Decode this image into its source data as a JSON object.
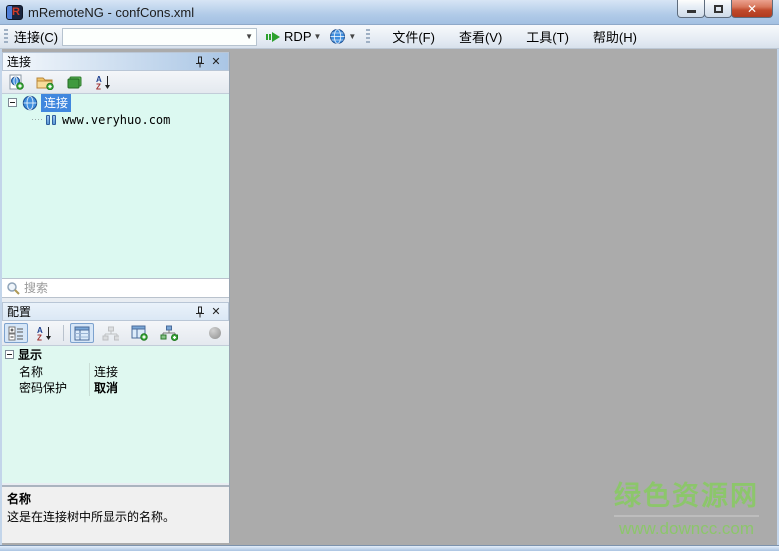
{
  "window": {
    "title": "mRemoteNG - confCons.xml"
  },
  "toolbar": {
    "quick_connect_label": "连接(C)",
    "quick_connect_value": "",
    "protocol_label": "RDP",
    "menu": [
      {
        "label": "文件(F)"
      },
      {
        "label": "查看(V)"
      },
      {
        "label": "工具(T)"
      },
      {
        "label": "帮助(H)"
      }
    ]
  },
  "connections_panel": {
    "title": "连接",
    "tree": {
      "root_label": "连接",
      "child_label": "www.veryhuo.com"
    },
    "search_placeholder": "搜索"
  },
  "config_panel": {
    "title": "配置",
    "category_label": "显示",
    "rows": [
      {
        "name": "名称",
        "value": "连接"
      },
      {
        "name": "密码保护",
        "value": "取消"
      }
    ],
    "help_title": "名称",
    "help_text": "这是在连接树中所显示的名称。"
  },
  "watermark": {
    "line1": "绿色资源网",
    "line2": "www.downcc.com"
  },
  "colors": {
    "workspace_gray": "#ababab",
    "tree_background": "#dcf9f1",
    "selection_blue": "#4087de",
    "watermark_green": "#8cc66b",
    "titlebar_blue": "#b1cbe8",
    "close_button_red": "#c04a2c"
  }
}
